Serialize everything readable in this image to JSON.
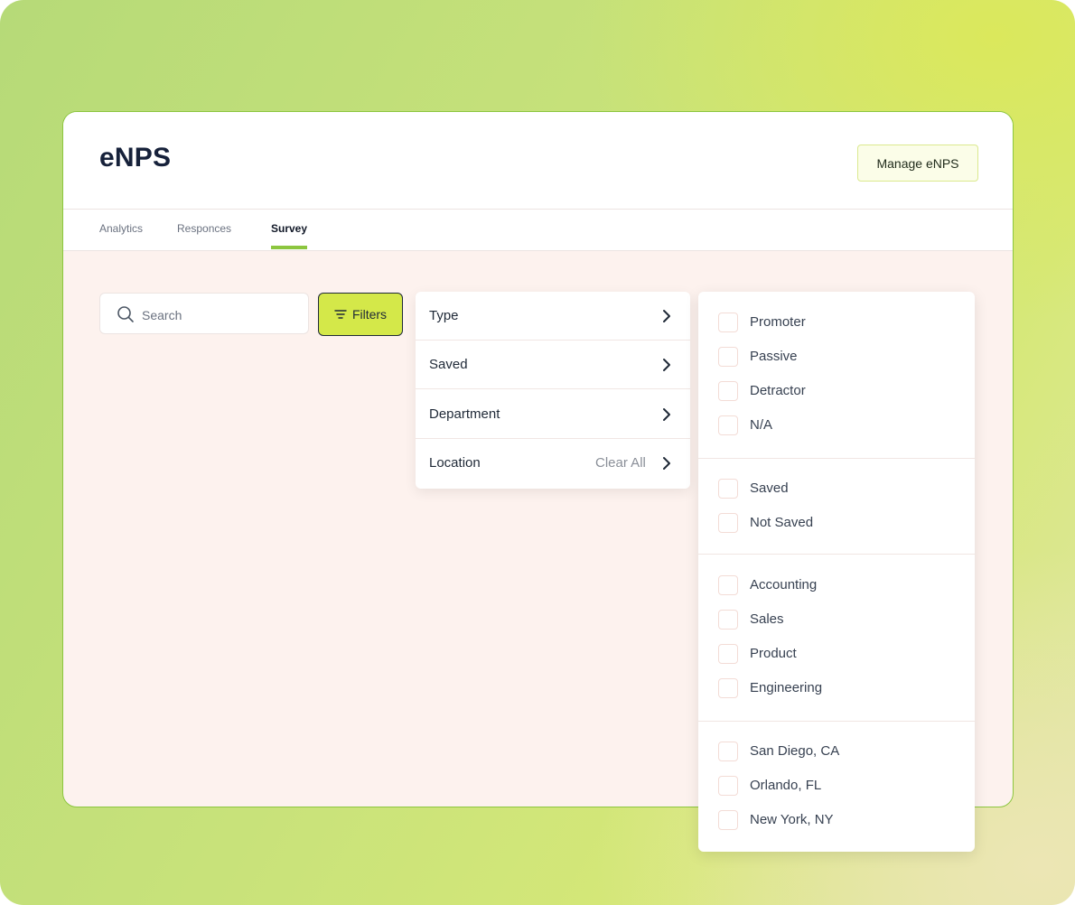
{
  "header": {
    "title": "eNPS",
    "manage_button": "Manage eNPS"
  },
  "tabs": [
    {
      "label": "Analytics",
      "active": false
    },
    {
      "label": "Responces",
      "active": false
    },
    {
      "label": "Survey",
      "active": true
    }
  ],
  "toolbar": {
    "search_placeholder": "Search",
    "filters_label": "Filters"
  },
  "filter_menu": {
    "items": [
      {
        "label": "Type"
      },
      {
        "label": "Saved"
      },
      {
        "label": "Department"
      },
      {
        "label": "Location"
      }
    ],
    "clear_all_label": "Clear All"
  },
  "filter_options": {
    "groups": [
      {
        "options": [
          "Promoter",
          "Passive",
          "Detractor",
          "N/A"
        ]
      },
      {
        "options": [
          "Saved",
          "Not Saved"
        ]
      },
      {
        "options": [
          "Accounting",
          "Sales",
          "Product",
          "Engineering"
        ]
      },
      {
        "options": [
          "San Diego, CA",
          "Orlando, FL",
          "New York, NY"
        ]
      }
    ]
  },
  "colors": {
    "accent": "#8cc63f",
    "filters_button": "#d4e849",
    "card_body": "#fdf2ee"
  }
}
